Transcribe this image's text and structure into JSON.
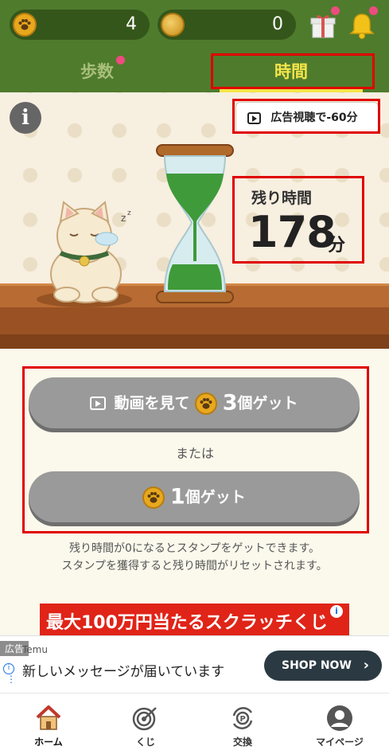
{
  "header": {
    "paw_count": "4",
    "coin_count": "0",
    "paw_icon": "paw-icon",
    "coin_icon": "coin-icon",
    "gift_icon": "gift-icon",
    "bell_icon": "bell-icon"
  },
  "tabs": [
    {
      "label": "歩数",
      "active": false
    },
    {
      "label": "時間",
      "active": true
    }
  ],
  "scene": {
    "info_label": "i",
    "ad_watch_label": "広告視聴で-60分",
    "remaining_label": "残り時間",
    "remaining_value": "178",
    "remaining_unit": "分"
  },
  "actions": {
    "video_button": {
      "prefix": "動画を見て",
      "count": "3",
      "suffix": "個ゲット"
    },
    "or_label": "または",
    "get_button": {
      "count": "1",
      "suffix": "個ゲット"
    }
  },
  "notes": [
    "残り時間が0になるとスタンプをゲットできます。",
    "スタンプを獲得すると残り時間がリセットされます。"
  ],
  "promo": {
    "text": "最大100万円当たるスクラッチくじ"
  },
  "ad_banner": {
    "tag": "広告",
    "brand": "Temu",
    "message": "新しいメッセージが届いています",
    "cta": "SHOP NOW"
  },
  "bottom_nav": [
    {
      "label": "ホーム",
      "icon": "home-icon",
      "active": true
    },
    {
      "label": "くじ",
      "icon": "target-icon",
      "active": false
    },
    {
      "label": "交換",
      "icon": "exchange-icon",
      "active": false
    },
    {
      "label": "マイページ",
      "icon": "user-icon",
      "active": false
    }
  ],
  "colors": {
    "header_green": "#4f7b2d",
    "active_tab": "#f4e54a",
    "button_gray": "#9a9a9a",
    "highlight_red": "#e00000"
  }
}
